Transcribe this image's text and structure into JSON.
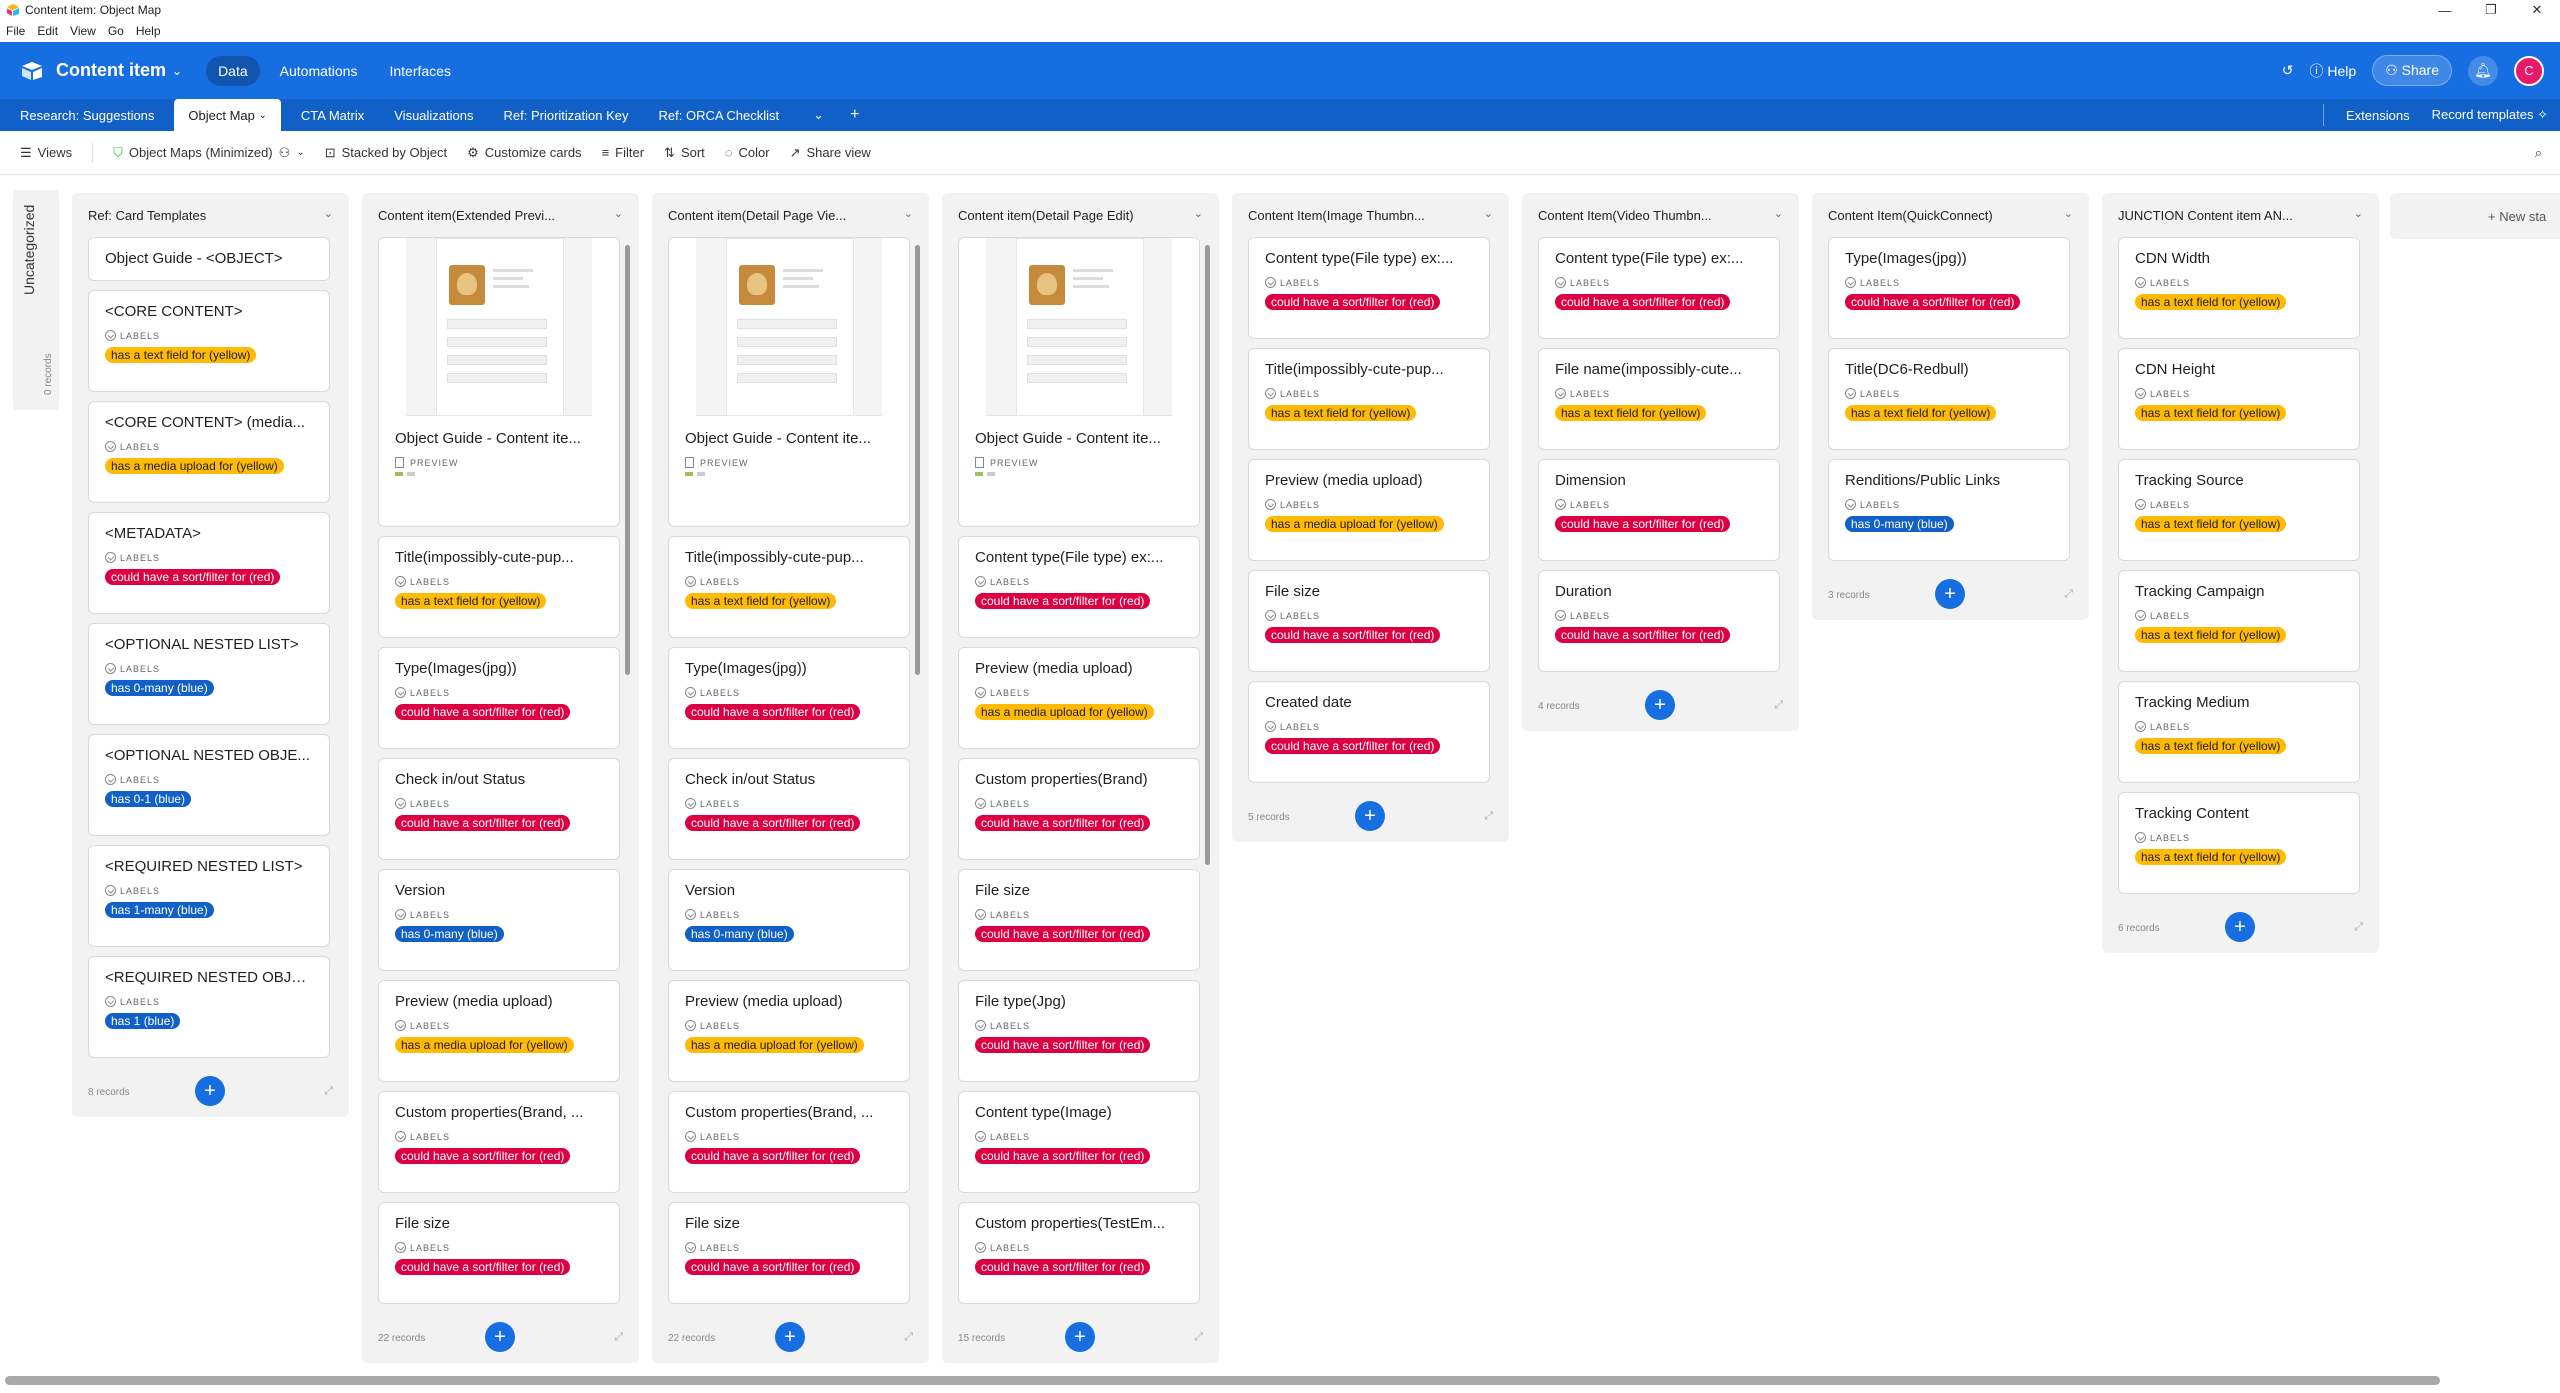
{
  "window": {
    "title": "Content item: Object Map",
    "menu": [
      "File",
      "Edit",
      "View",
      "Go",
      "Help"
    ],
    "controls": [
      "—",
      "❐",
      "✕"
    ]
  },
  "header": {
    "base_name": "Content item",
    "nav": [
      "Data",
      "Automations",
      "Interfaces"
    ],
    "help": "Help",
    "share": "Share",
    "avatar": "C"
  },
  "tabs": [
    "Research: Suggestions",
    "Object Map",
    "CTA Matrix",
    "Visualizations",
    "Ref: Prioritization Key",
    "Ref: ORCA Checklist"
  ],
  "tabs_right": [
    "Extensions",
    "Record templates"
  ],
  "toolbar": {
    "views": "Views",
    "view_name": "Object Maps (Minimized)",
    "stacked": "Stacked by Object",
    "customize": "Customize cards",
    "filter": "Filter",
    "sort": "Sort",
    "color": "Color",
    "share_view": "Share view"
  },
  "uncategorized": {
    "label": "Uncategorized",
    "count": "0 records"
  },
  "field_label": "LABELS",
  "preview_label": "PREVIEW",
  "new_stack": "New sta",
  "stacks": [
    {
      "title": "Ref: Card Templates",
      "count": "8 records",
      "cards": [
        {
          "title": "Object Guide - <OBJECT>",
          "short": true
        },
        {
          "title": "<CORE CONTENT>",
          "pill": "has a text field for (yellow)",
          "color": "yellow"
        },
        {
          "title": "<CORE CONTENT> (media...",
          "pill": "has a media upload for (yellow)",
          "color": "yellow"
        },
        {
          "title": "<METADATA>",
          "pill": "could have a sort/filter for (red)",
          "color": "red"
        },
        {
          "title": "<OPTIONAL NESTED LIST>",
          "pill": "has 0-many (blue)",
          "color": "blue"
        },
        {
          "title": "<OPTIONAL NESTED OBJE...",
          "pill": "has 0-1 (blue)",
          "color": "blue"
        },
        {
          "title": "<REQUIRED NESTED LIST>",
          "pill": "has 1-many (blue)",
          "color": "blue"
        },
        {
          "title": "<REQUIRED NESTED OBJE...",
          "pill": "has 1 (blue)",
          "color": "blue"
        }
      ]
    },
    {
      "title": "Content item(Extended Previ...",
      "count": "22 records",
      "cards": [
        {
          "title": "Object Guide - Content ite...",
          "preview": true
        },
        {
          "title": "Title(impossibly-cute-pup...",
          "pill": "has a text field for (yellow)",
          "color": "yellow"
        },
        {
          "title": "Type(Images(jpg))",
          "pill": "could have a sort/filter for (red)",
          "color": "red"
        },
        {
          "title": "Check in/out Status",
          "pill": "could have a sort/filter for (red)",
          "color": "red"
        },
        {
          "title": "Version",
          "pill": "has 0-many (blue)",
          "color": "blue"
        },
        {
          "title": "Preview (media upload)",
          "pill": "has a media upload for (yellow)",
          "color": "yellow"
        },
        {
          "title": "Custom properties(Brand, ...",
          "pill": "could have a sort/filter for (red)",
          "color": "red"
        },
        {
          "title": "File size",
          "pill": "could have a sort/filter for (red)",
          "color": "red"
        }
      ]
    },
    {
      "title": "Content item(Detail Page Vie...",
      "count": "22 records",
      "cards": [
        {
          "title": "Object Guide - Content ite...",
          "preview": true
        },
        {
          "title": "Title(impossibly-cute-pup...",
          "pill": "has a text field for (yellow)",
          "color": "yellow"
        },
        {
          "title": "Type(Images(jpg))",
          "pill": "could have a sort/filter for (red)",
          "color": "red"
        },
        {
          "title": "Check in/out Status",
          "pill": "could have a sort/filter for (red)",
          "color": "red"
        },
        {
          "title": "Version",
          "pill": "has 0-many (blue)",
          "color": "blue"
        },
        {
          "title": "Preview (media upload)",
          "pill": "has a media upload for (yellow)",
          "color": "yellow"
        },
        {
          "title": "Custom properties(Brand, ...",
          "pill": "could have a sort/filter for (red)",
          "color": "red"
        },
        {
          "title": "File size",
          "pill": "could have a sort/filter for (red)",
          "color": "red"
        }
      ]
    },
    {
      "title": "Content item(Detail Page Edit)",
      "count": "15 records",
      "cards": [
        {
          "title": "Object Guide - Content ite...",
          "preview": true
        },
        {
          "title": "Content type(File type) ex:...",
          "pill": "could have a sort/filter for (red)",
          "color": "red"
        },
        {
          "title": "Preview (media upload)",
          "pill": "has a media upload for (yellow)",
          "color": "yellow"
        },
        {
          "title": "Custom properties(Brand)",
          "pill": "could have a sort/filter for (red)",
          "color": "red"
        },
        {
          "title": "File size",
          "pill": "could have a sort/filter for (red)",
          "color": "red"
        },
        {
          "title": "File type(Jpg)",
          "pill": "could have a sort/filter for (red)",
          "color": "red"
        },
        {
          "title": "Content type(Image)",
          "pill": "could have a sort/filter for (red)",
          "color": "red"
        },
        {
          "title": "Custom properties(TestEm...",
          "pill": "could have a sort/filter for (red)",
          "color": "red"
        }
      ]
    },
    {
      "title": "Content Item(Image Thumbn...",
      "count": "5 records",
      "cards": [
        {
          "title": "Content type(File type) ex:...",
          "pill": "could have a sort/filter for (red)",
          "color": "red"
        },
        {
          "title": "Title(impossibly-cute-pup...",
          "pill": "has a text field for (yellow)",
          "color": "yellow"
        },
        {
          "title": "Preview (media upload)",
          "pill": "has a media upload for (yellow)",
          "color": "yellow"
        },
        {
          "title": "File size",
          "pill": "could have a sort/filter for (red)",
          "color": "red"
        },
        {
          "title": "Created date",
          "pill": "could have a sort/filter for (red)",
          "color": "red"
        }
      ]
    },
    {
      "title": "Content Item(Video Thumbn...",
      "count": "4 records",
      "cards": [
        {
          "title": "Content type(File type) ex:...",
          "pill": "could have a sort/filter for (red)",
          "color": "red"
        },
        {
          "title": "File name(impossibly-cute...",
          "pill": "has a text field for (yellow)",
          "color": "yellow"
        },
        {
          "title": "Dimension",
          "pill": "could have a sort/filter for (red)",
          "color": "red"
        },
        {
          "title": "Duration",
          "pill": "could have a sort/filter for (red)",
          "color": "red"
        }
      ]
    },
    {
      "title": "Content Item(QuickConnect)",
      "count": "3 records",
      "cards": [
        {
          "title": "Type(Images(jpg))",
          "pill": "could have a sort/filter for (red)",
          "color": "red"
        },
        {
          "title": "Title(DC6-Redbull)",
          "pill": "has a text field for (yellow)",
          "color": "yellow"
        },
        {
          "title": "Renditions/Public Links",
          "pill": "has 0-many (blue)",
          "color": "blue"
        }
      ]
    },
    {
      "title": "JUNCTION Content item AN...",
      "count": "6 records",
      "cards": [
        {
          "title": "CDN Width",
          "pill": "has a text field for (yellow)",
          "color": "yellow"
        },
        {
          "title": "CDN Height",
          "pill": "has a text field for (yellow)",
          "color": "yellow"
        },
        {
          "title": "Tracking Source",
          "pill": "has a text field for (yellow)",
          "color": "yellow"
        },
        {
          "title": "Tracking Campaign",
          "pill": "has a text field for (yellow)",
          "color": "yellow"
        },
        {
          "title": "Tracking Medium",
          "pill": "has a text field for (yellow)",
          "color": "yellow"
        },
        {
          "title": "Tracking Content",
          "pill": "has a text field for (yellow)",
          "color": "yellow"
        }
      ]
    }
  ]
}
